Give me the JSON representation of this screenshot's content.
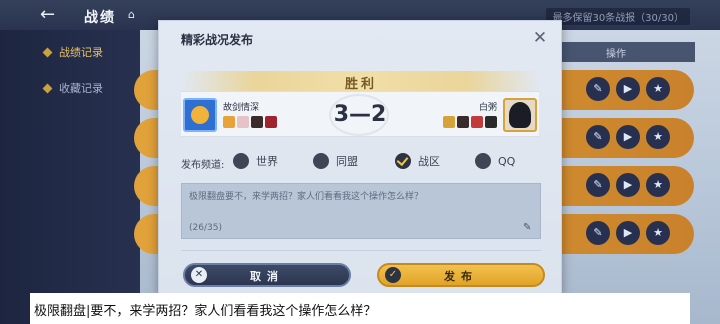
{
  "header": {
    "title": "战绩",
    "save_limit": "最多保留30条战报（30/30）"
  },
  "sidebar": {
    "items": [
      {
        "label": "战绩记录"
      },
      {
        "label": "收藏记录"
      }
    ]
  },
  "list": {
    "column_header": "操作"
  },
  "modal": {
    "title": "精彩战况发布",
    "result": "胜利",
    "score": "3—2",
    "left_player": "故剑情深",
    "right_player": "白粥",
    "channel_label": "发布频道:",
    "channels": [
      {
        "label": "世界",
        "selected": false
      },
      {
        "label": "同盟",
        "selected": false
      },
      {
        "label": "战区",
        "selected": true
      },
      {
        "label": "QQ",
        "selected": false
      }
    ],
    "message": "极限翻盘要不，来学两招？家人们看看我这个操作怎么样？",
    "char_count": "(26/35)",
    "cancel_label": "取消",
    "publish_label": "发布"
  },
  "caption": {
    "text": "极限翻盘|要不，来学两招？家人们看看我这个操作怎么样？"
  },
  "colors": {
    "accent_gold": "#e1a329",
    "modal_bg": "#e3e9f2",
    "dark_navy": "#2c3650"
  },
  "icons": {
    "back": "back-arrow-icon",
    "home": "home-icon",
    "close": "close-icon",
    "edit": "edit-pencil-icon",
    "cancel": "close-circle-icon",
    "publish": "check-circle-icon"
  }
}
